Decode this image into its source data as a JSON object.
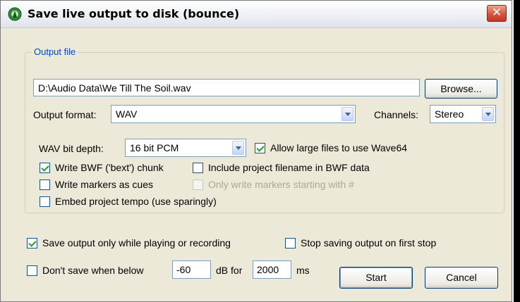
{
  "window": {
    "title": "Save live output to disk (bounce)",
    "icon": "reaper-icon",
    "close_icon": "close-icon"
  },
  "group": {
    "label": "Output file"
  },
  "output_file": {
    "path": "D:\\Audio Data\\We Till The Soil.wav",
    "browse_label": "Browse..."
  },
  "format": {
    "label": "Output format:",
    "value": "WAV"
  },
  "channels": {
    "label": "Channels:",
    "value": "Stereo"
  },
  "bit_depth": {
    "label": "WAV bit depth:",
    "value": "16 bit PCM"
  },
  "options": {
    "allow_large_files": {
      "label": "Allow large files to use Wave64",
      "checked": true
    },
    "write_bwf": {
      "label": "Write BWF ('bext') chunk",
      "checked": true
    },
    "include_filename": {
      "label": "Include project filename in BWF data",
      "checked": false
    },
    "write_markers": {
      "label": "Write markers as cues",
      "checked": false
    },
    "only_markers_hash": {
      "label": "Only write markers starting with #",
      "checked": false,
      "disabled": true
    },
    "embed_tempo": {
      "label": "Embed project tempo (use sparingly)",
      "checked": false
    }
  },
  "save_only_playing": {
    "label": "Save output only while playing or recording",
    "checked": true
  },
  "stop_first_stop": {
    "label": "Stop saving output on first stop",
    "checked": false
  },
  "threshold": {
    "label": "Don't save when below",
    "checked": false,
    "db_value": "-60",
    "db_label": "dB for",
    "ms_value": "2000",
    "ms_label": "ms"
  },
  "buttons": {
    "start": "Start",
    "cancel": "Cancel"
  }
}
